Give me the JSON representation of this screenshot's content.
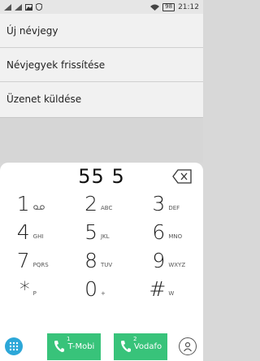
{
  "status": {
    "battery": "98",
    "time": "21:12"
  },
  "menu": {
    "items": [
      "Új névjegy",
      "Névjegyek frissítése",
      "Üzenet küldése"
    ]
  },
  "dialer": {
    "number": "55 5",
    "keys": [
      {
        "digit": "1",
        "letters": ""
      },
      {
        "digit": "2",
        "letters": "ABC"
      },
      {
        "digit": "3",
        "letters": "DEF"
      },
      {
        "digit": "4",
        "letters": "GHI"
      },
      {
        "digit": "5",
        "letters": "JKL"
      },
      {
        "digit": "6",
        "letters": "MNO"
      },
      {
        "digit": "7",
        "letters": "PQRS"
      },
      {
        "digit": "8",
        "letters": "TUV"
      },
      {
        "digit": "9",
        "letters": "WXYZ"
      },
      {
        "digit": "*",
        "letters": "P"
      },
      {
        "digit": "0",
        "letters": "+"
      },
      {
        "digit": "#",
        "letters": "W"
      }
    ]
  },
  "calls": {
    "sim1": {
      "slot": "1",
      "label": "T-Mobi"
    },
    "sim2": {
      "slot": "2",
      "label": "Vodafo"
    }
  },
  "colors": {
    "call_green": "#38c37a",
    "dialpad_blue": "#2ca7d8"
  }
}
